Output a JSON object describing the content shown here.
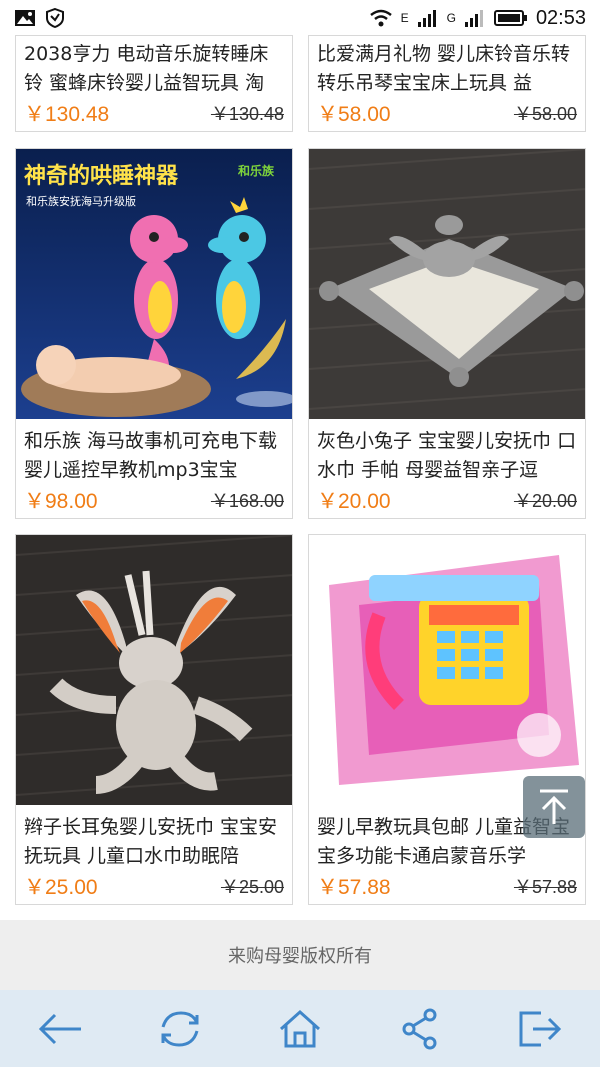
{
  "status_bar": {
    "network_e": "E",
    "network_g": "G",
    "time": "02:53"
  },
  "products": [
    {
      "title": "2038亨力 电动音乐旋转睡床铃 蜜蜂床铃婴儿益智玩具 淘",
      "price": "￥130.48",
      "old_price": "￥130.48"
    },
    {
      "title": "比爱满月礼物 婴儿床铃音乐转转乐吊琴宝宝床上玩具 益",
      "price": "￥58.00",
      "old_price": "￥58.00"
    },
    {
      "title": "和乐族 海马故事机可充电下载 婴儿遥控早教机mp3宝宝",
      "price": "￥98.00",
      "old_price": "￥168.00",
      "image_text": {
        "headline": "神奇的哄睡神器",
        "subline": "和乐族安抚海马升级版",
        "logo": "和乐族"
      }
    },
    {
      "title": "灰色小兔子 宝宝婴儿安抚巾 口水巾 手帕 母婴益智亲子逗",
      "price": "￥20.00",
      "old_price": "￥20.00"
    },
    {
      "title": "辫子长耳兔婴儿安抚巾 宝宝安抚玩具 儿童口水巾助眠陪",
      "price": "￥25.00",
      "old_price": "￥25.00"
    },
    {
      "title": "婴儿早教玩具包邮 儿童益智宝宝多功能卡通启蒙音乐学",
      "price": "￥57.88",
      "old_price": "￥57.88"
    }
  ],
  "footer": {
    "copyright": "来购母婴版权所有"
  },
  "icons": {
    "back": "arrow-left-icon",
    "refresh": "refresh-icon",
    "home": "home-icon",
    "share": "share-icon",
    "exit": "exit-icon",
    "back_to_top": "arrow-up-icon"
  },
  "colors": {
    "price": "#f07d16",
    "toolbar_bg": "#dfeaf3",
    "toolbar_icon": "#3f86c9",
    "footer_bg": "#eeeeee"
  }
}
